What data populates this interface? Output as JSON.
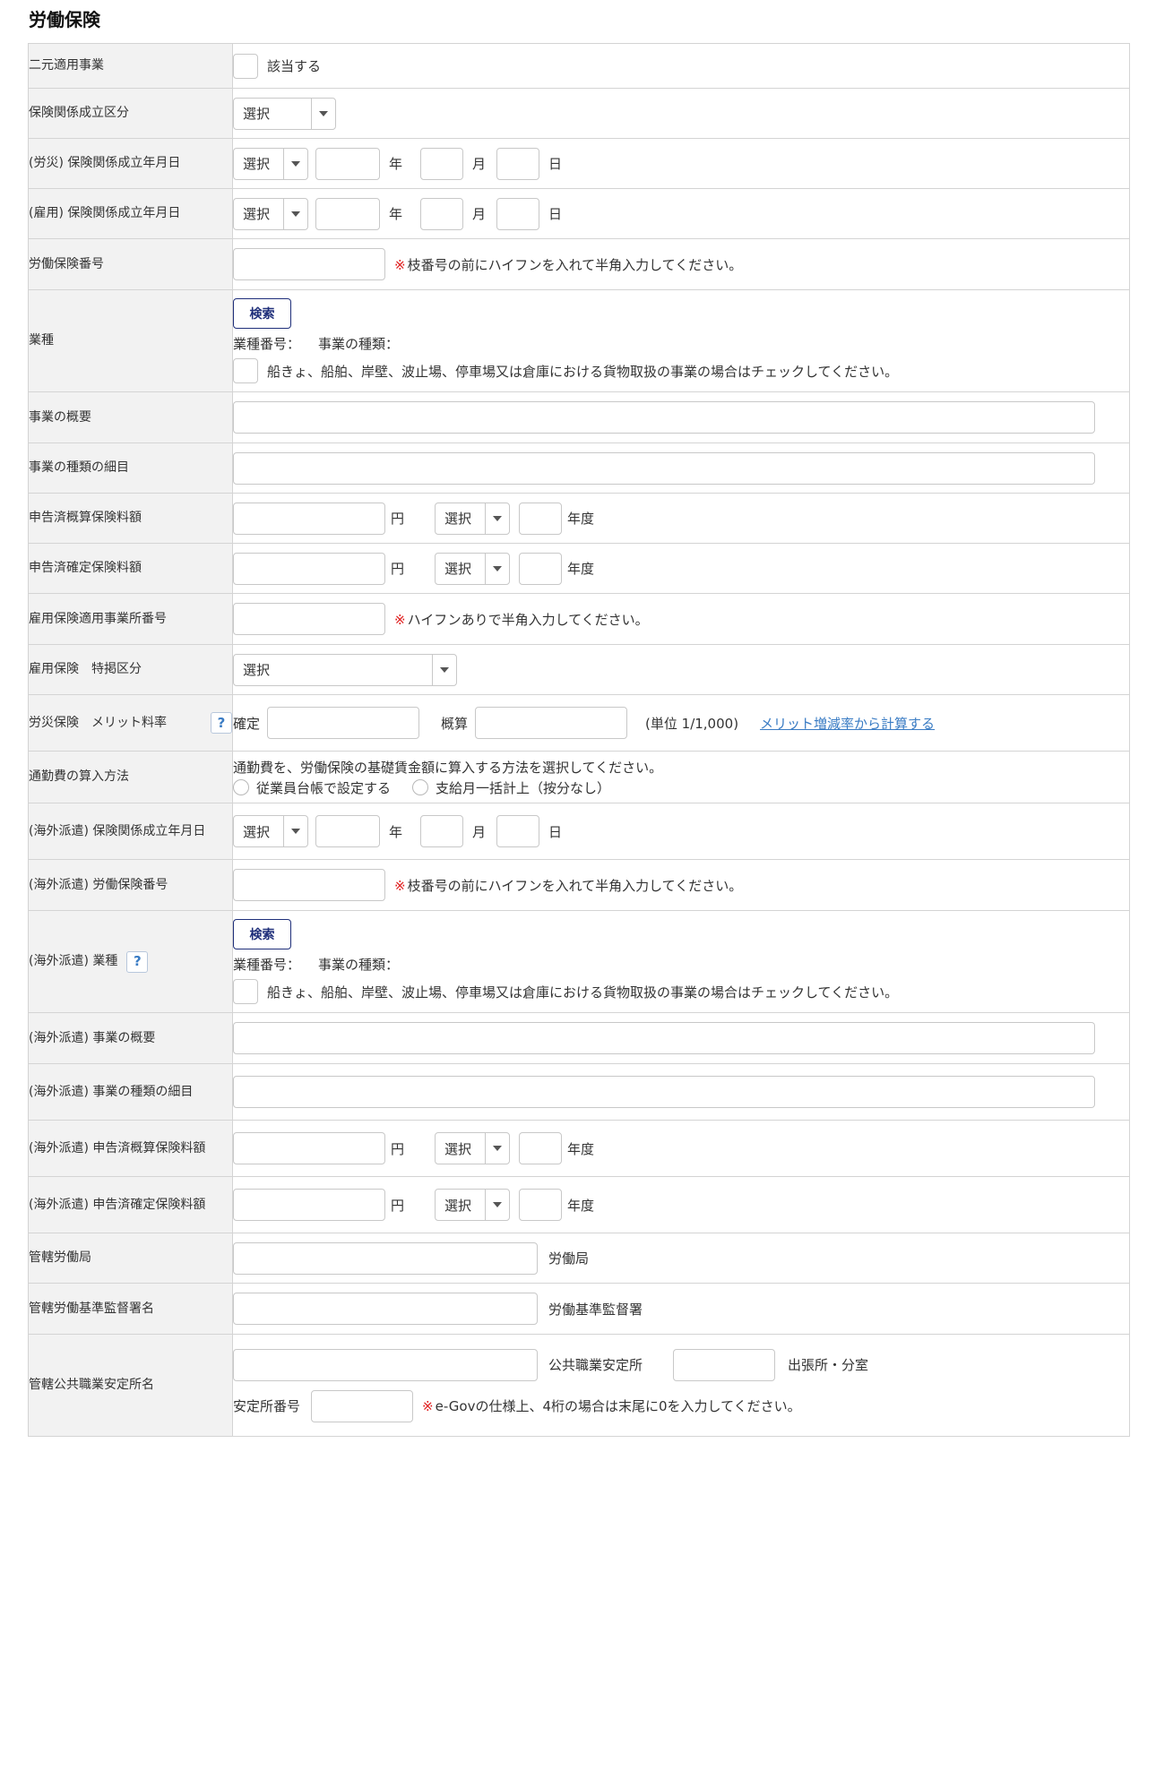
{
  "section_title": "労働保険",
  "select_default": "選択",
  "rows": {
    "dual": {
      "label": "二元適用事業",
      "checkbox_label": "該当する"
    },
    "est_class": {
      "label": "保険関係成立区分"
    },
    "rousai_date": {
      "label": "(労災) 保険関係成立年月日"
    },
    "koyou_date": {
      "label": "(雇用) 保険関係成立年月日"
    },
    "labor_no": {
      "label": "労働保険番号",
      "note": "枝番号の前にハイフンを入れて半角入力してください。"
    },
    "industry": {
      "label": "業種",
      "search_button": "検索",
      "code_label": "業種番号：",
      "kind_label": "事業の種類：",
      "cargo_check": "船きょ、船舶、岸壁、波止場、停車場又は倉庫における貨物取扱の事業の場合はチェックしてください。"
    },
    "overview": {
      "label": "事業の概要"
    },
    "kind_detail": {
      "label": "事業の種類の細目"
    },
    "est_premium": {
      "label": "申告済概算保険料額"
    },
    "conf_premium": {
      "label": "申告済確定保険料額"
    },
    "emp_office_no": {
      "label": "雇用保険適用事業所番号",
      "note": "ハイフンありで半角入力してください。"
    },
    "emp_special": {
      "label": "雇用保険　特掲区分"
    },
    "merit": {
      "label": "労災保険　メリット料率",
      "confirmed": "確定",
      "estimated": "概算",
      "unit": "(単位 1/1,000)",
      "link": "メリット増減率から計算する"
    },
    "commute": {
      "label": "通勤費の算入方法",
      "desc": "通勤費を、労働保険の基礎賃金額に算入する方法を選択してください。",
      "options": [
        "従業員台帳で設定する",
        "支給月一括計上（按分なし）"
      ]
    },
    "abroad_date": {
      "label": "(海外派遣) 保険関係成立年月日"
    },
    "abroad_labor_no": {
      "label": "(海外派遣) 労働保険番号",
      "note": "枝番号の前にハイフンを入れて半角入力してください。"
    },
    "abroad_industry": {
      "label": "(海外派遣) 業種",
      "search_button": "検索",
      "code_label": "業種番号：",
      "kind_label": "事業の種類：",
      "cargo_check": "船きょ、船舶、岸壁、波止場、停車場又は倉庫における貨物取扱の事業の場合はチェックしてください。"
    },
    "abroad_overview": {
      "label": "(海外派遣) 事業の概要"
    },
    "abroad_kind_detail": {
      "label": "(海外派遣) 事業の種類の細目"
    },
    "abroad_est_premium": {
      "label": "(海外派遣) 申告済概算保険料額"
    },
    "abroad_conf_premium": {
      "label": "(海外派遣) 申告済確定保険料額"
    },
    "labor_bureau": {
      "label": "管轄労働局",
      "suffix": "労働局"
    },
    "inspection_office": {
      "label": "管轄労働基準監督署名",
      "suffix": "労働基準監督署"
    },
    "employment_office": {
      "label": "管轄公共職業安定所名",
      "suffix": "公共職業安定所",
      "branch_suffix": "出張所・分室",
      "office_no_label": "安定所番号",
      "note": "e-Govの仕様上、4桁の場合は末尾に0を入力してください。"
    }
  },
  "units": {
    "year": "年",
    "month": "月",
    "day": "日",
    "yen": "円",
    "fiscal_year": "年度"
  },
  "note_mark": "※",
  "help_mark": "?"
}
